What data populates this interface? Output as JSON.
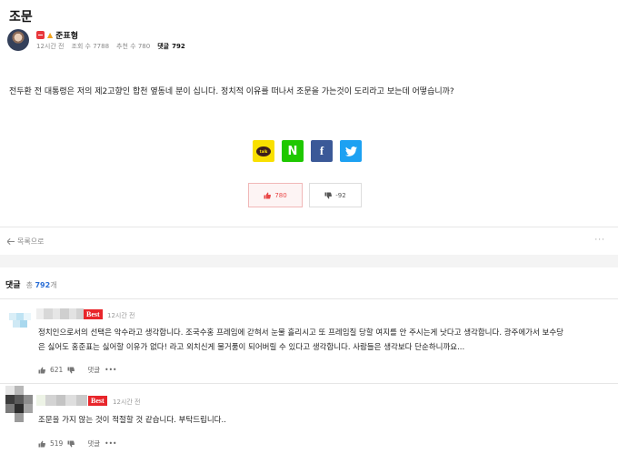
{
  "post": {
    "title": "조문",
    "author": "준표형",
    "time": "12시간 전",
    "views": "조회 수 7788",
    "recommends": "추천 수 780",
    "comments_label": "댓글",
    "comments_count": "792",
    "body": "전두환 전 대통령은 저의 제2고향인 합천 옆동네 분이 십니다. 정치적 이유를 떠나서 조문을 가는것이 도리라고 보는데 어떻습니까?"
  },
  "share": {
    "kakao": "talk",
    "naver": "N",
    "facebook": "f",
    "twitter": "🐦"
  },
  "votes": {
    "up": "780",
    "down": "-92"
  },
  "nav": {
    "back": "목록으로",
    "more": "···"
  },
  "comments": {
    "label": "댓글",
    "total_prefix": "총",
    "total": "792",
    "total_suffix": "개",
    "items": [
      {
        "badge": "Best",
        "time": "12시간 전",
        "text_line1": "정치인으로서의 선택은 악수라고 생각합니다. 조국수홍 프레임에 갇혀서 눈물 흘리시고 또 프레임질 당할 여지를 안 주시는게 낫다고 생각합니다. 광주에가서 보수당",
        "text_line2": "은 싫어도 홍준표는 싫어할 이유가 없다! 라고 외치신게 물거품이 되어버릴 수 있다고 생각합니다. 사람들은 생각보다 단순하니까요...",
        "likes": "621",
        "reply": "댓글",
        "more": "•••"
      },
      {
        "badge": "Best",
        "time": "12시간 전",
        "text_line1": "조문을 가지 않는 것이 적절할 것 같습니다. 부탁드립니다..",
        "likes": "519",
        "reply": "댓글",
        "more": "•••"
      }
    ]
  },
  "colors": {
    "accent_blue": "#2b6fd6",
    "best_red": "#e8262b",
    "upvote_red": "#e94747"
  }
}
